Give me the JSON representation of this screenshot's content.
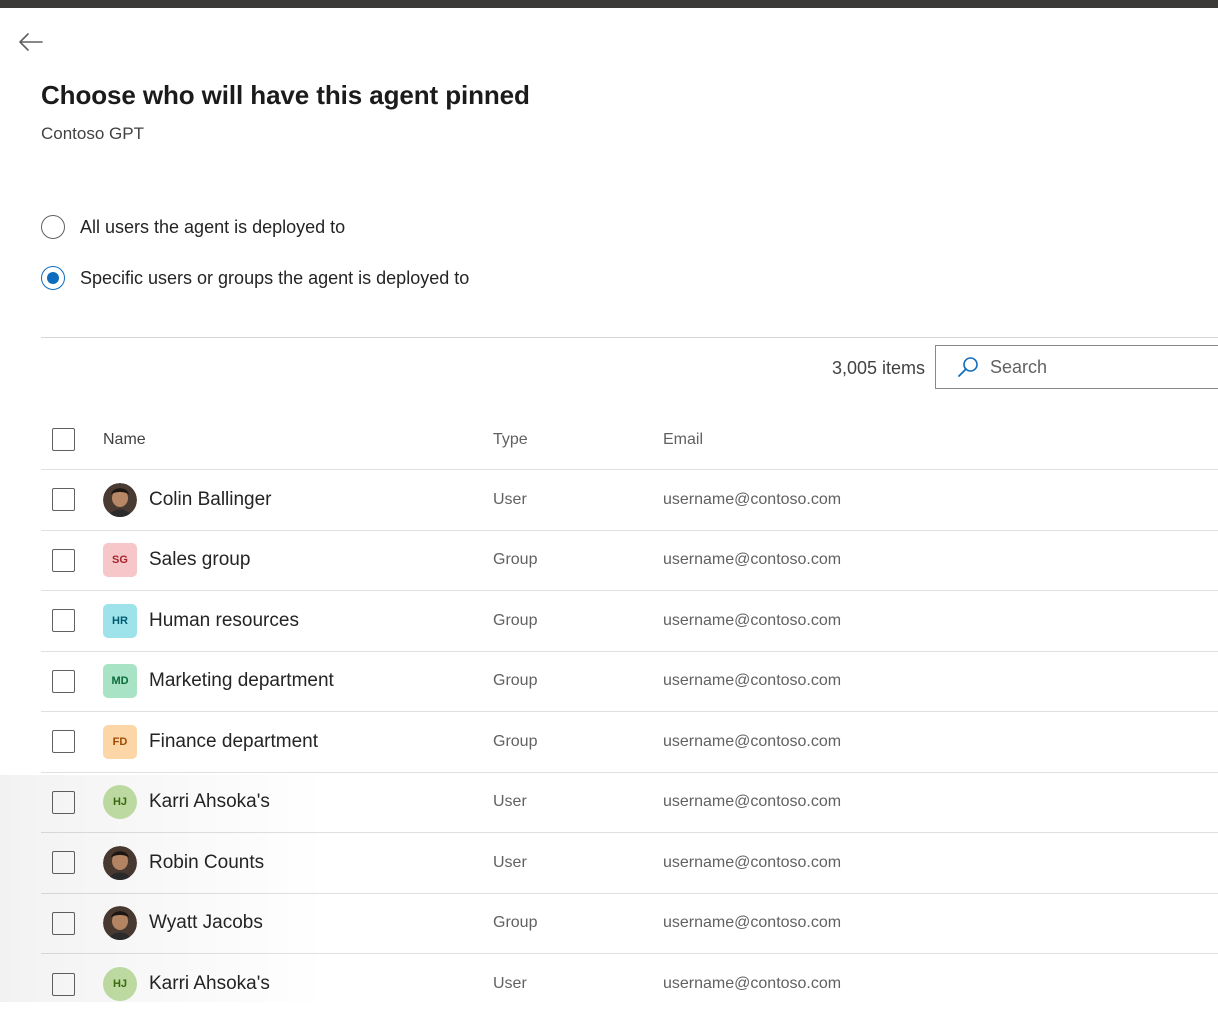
{
  "page": {
    "title": "Choose who will have this agent pinned",
    "subtitle": "Contoso GPT"
  },
  "pin_options": [
    {
      "label": "All users the agent is deployed to",
      "checked": false
    },
    {
      "label": "Specific users or groups the agent is deployed to",
      "checked": true
    }
  ],
  "toolbar": {
    "item_count": "3,005 items",
    "search_placeholder": "Search"
  },
  "table": {
    "columns": {
      "name": "Name",
      "type": "Type",
      "email": "Email"
    },
    "rows": [
      {
        "name": "Colin Ballinger",
        "type": "User",
        "email": "username@contoso.com",
        "avatar": {
          "kind": "photo"
        }
      },
      {
        "name": "Sales group",
        "type": "Group",
        "email": "username@contoso.com",
        "avatar": {
          "kind": "initials",
          "shape": "square",
          "initials": "SG",
          "bg": "#f6c6c9",
          "fg": "#a4262c"
        }
      },
      {
        "name": "Human resources",
        "type": "Group",
        "email": "username@contoso.com",
        "avatar": {
          "kind": "initials",
          "shape": "square",
          "initials": "HR",
          "bg": "#9fe3ea",
          "fg": "#005b70"
        }
      },
      {
        "name": "Marketing department",
        "type": "Group",
        "email": "username@contoso.com",
        "avatar": {
          "kind": "initials",
          "shape": "square",
          "initials": "MD",
          "bg": "#a7e3c4",
          "fg": "#0b6a3b"
        }
      },
      {
        "name": "Finance department",
        "type": "Group",
        "email": "username@contoso.com",
        "avatar": {
          "kind": "initials",
          "shape": "square",
          "initials": "FD",
          "bg": "#fdd6a8",
          "fg": "#a04a00"
        }
      },
      {
        "name": "Karri Ahsoka's",
        "type": "User",
        "email": "username@contoso.com",
        "avatar": {
          "kind": "initials",
          "shape": "circle",
          "initials": "HJ",
          "bg": "#c2e0a6",
          "fg": "#3c6a0f"
        }
      },
      {
        "name": "Robin Counts",
        "type": "User",
        "email": "username@contoso.com",
        "avatar": {
          "kind": "photo"
        }
      },
      {
        "name": "Wyatt Jacobs",
        "type": "Group",
        "email": "username@contoso.com",
        "avatar": {
          "kind": "photo"
        }
      },
      {
        "name": "Karri Ahsoka's",
        "type": "User",
        "email": "username@contoso.com",
        "avatar": {
          "kind": "initials",
          "shape": "circle",
          "initials": "HJ",
          "bg": "#c2e0a6",
          "fg": "#3c6a0f"
        }
      }
    ]
  },
  "colors": {
    "accent": "#0f6cbd",
    "text_primary": "#242424",
    "text_secondary": "#616161",
    "divider": "#e0e0e0"
  }
}
